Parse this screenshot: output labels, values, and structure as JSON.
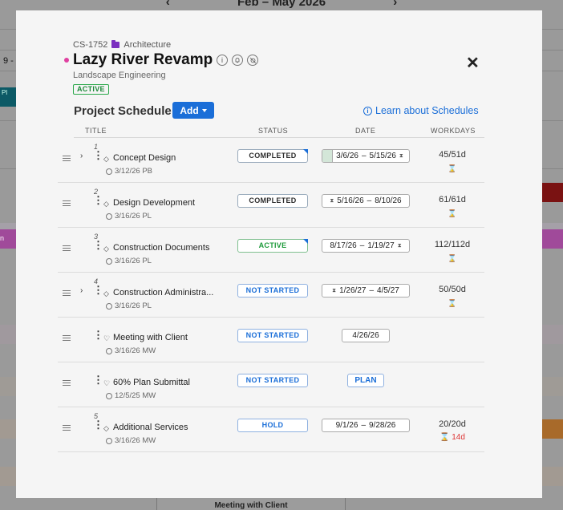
{
  "background": {
    "calendar_title": "Feb – May 2026",
    "row_label": "9 -",
    "chip_text": "Pl",
    "pink_text": "n",
    "bottom_tab": "Meeting with Client"
  },
  "project": {
    "code": "CS-1752",
    "category": "Architecture",
    "title": "Lazy River Revamp",
    "subtitle": "Landscape Engineering",
    "status": "ACTIVE",
    "dot_color": "#e040a0"
  },
  "schedule": {
    "title": "Project Schedule",
    "add_label": "Add",
    "learn_label": "Learn about Schedules",
    "columns": {
      "title": "TITLE",
      "status": "STATUS",
      "date": "DATE",
      "workdays": "WORKDAYS"
    },
    "rows": [
      {
        "num": "1",
        "name": "Concept Design",
        "meta": "3/12/26 PB",
        "status": "COMPLETED",
        "start": "3/6/26",
        "sep": "–",
        "end": "5/15/26",
        "workdays": "45/51d"
      },
      {
        "num": "2",
        "name": "Design Development",
        "meta": "3/16/26 PL",
        "status": "COMPLETED",
        "start": "5/16/26",
        "sep": "–",
        "end": "8/10/26",
        "workdays": "61/61d"
      },
      {
        "num": "3",
        "name": "Construction Documents",
        "meta": "3/16/26 PL",
        "status": "ACTIVE",
        "start": "8/17/26",
        "sep": "–",
        "end": "1/19/27",
        "workdays": "112/112d"
      },
      {
        "num": "4",
        "name": "Construction Administra...",
        "meta": "3/16/26 PL",
        "status": "NOT STARTED",
        "start": "1/26/27",
        "sep": "–",
        "end": "4/5/27",
        "workdays": "50/50d"
      },
      {
        "name": "Meeting with Client",
        "meta": "3/16/26 MW",
        "status": "NOT STARTED",
        "date": "4/26/26"
      },
      {
        "name": "60% Plan Submittal",
        "meta": "12/5/25 MW",
        "status": "NOT STARTED",
        "plan": "PLAN"
      },
      {
        "num": "5",
        "name": "Additional Services",
        "meta": "3/16/26 MW",
        "status": "HOLD",
        "start": "9/1/26",
        "sep": "–",
        "end": "9/28/26",
        "workdays": "20/20d",
        "late": "14d"
      }
    ]
  }
}
